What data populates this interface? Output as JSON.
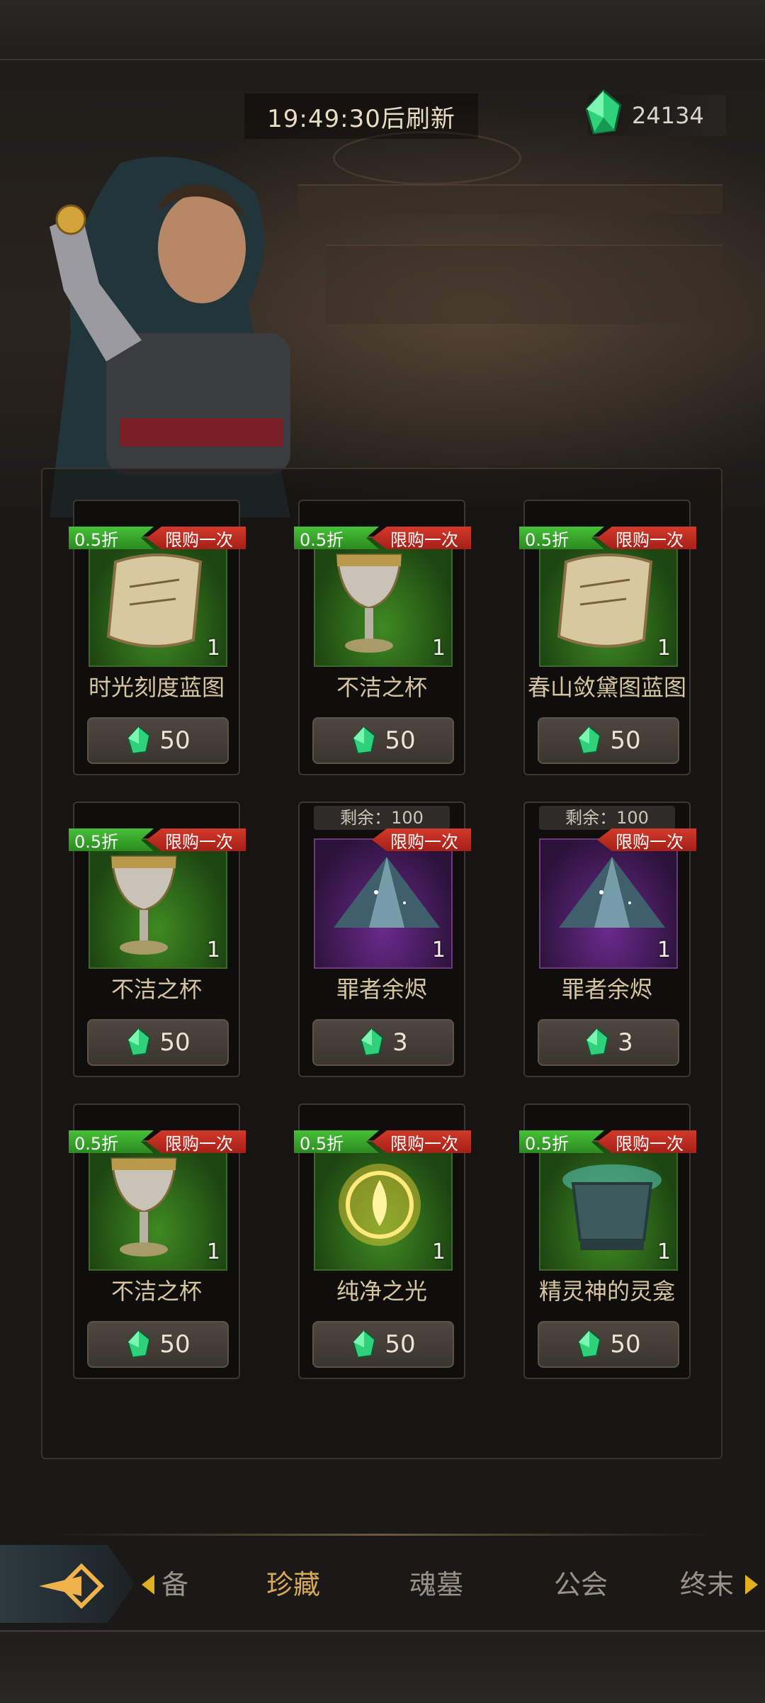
{
  "header": {
    "refresh_text": "19:49:30后刷新",
    "currency_amount": "24134"
  },
  "colors": {
    "discount_tag": "#3aa82c",
    "limit_tag": "#c52b20",
    "active_tab": "#d9a85a",
    "gem_green": "#2fd17a"
  },
  "shop": {
    "items": [
      {
        "discount": "0.5折",
        "limit": "限购一次",
        "name": "时光刻度蓝图",
        "qty": "1",
        "price": "50",
        "icon": "scroll-icon",
        "theme": "green"
      },
      {
        "discount": "0.5折",
        "limit": "限购一次",
        "name": "不洁之杯",
        "qty": "1",
        "price": "50",
        "icon": "chalice-icon",
        "theme": "green"
      },
      {
        "discount": "0.5折",
        "limit": "限购一次",
        "name": "春山敛黛图蓝图",
        "qty": "1",
        "price": "50",
        "icon": "scroll-icon",
        "theme": "green"
      },
      {
        "discount": "0.5折",
        "limit": "限购一次",
        "name": "不洁之杯",
        "qty": "1",
        "price": "50",
        "icon": "chalice-icon",
        "theme": "green"
      },
      {
        "remain": "剩余：100",
        "limit": "限购一次",
        "name": "罪者余烬",
        "qty": "1",
        "price": "3",
        "icon": "ember-pile-icon",
        "theme": "purple"
      },
      {
        "remain": "剩余：100",
        "limit": "限购一次",
        "name": "罪者余烬",
        "qty": "1",
        "price": "3",
        "icon": "ember-pile-icon",
        "theme": "purple"
      },
      {
        "discount": "0.5折",
        "limit": "限购一次",
        "name": "不洁之杯",
        "qty": "1",
        "price": "50",
        "icon": "chalice-icon",
        "theme": "green"
      },
      {
        "discount": "0.5折",
        "limit": "限购一次",
        "name": "纯净之光",
        "qty": "1",
        "price": "50",
        "icon": "light-orb-icon",
        "theme": "green"
      },
      {
        "discount": "0.5折",
        "limit": "限购一次",
        "name": "精灵神的灵龛",
        "qty": "1",
        "price": "50",
        "icon": "shrine-urn-icon",
        "theme": "green"
      }
    ]
  },
  "bottom_nav": {
    "tabs": [
      {
        "label": "备",
        "active": false
      },
      {
        "label": "珍藏",
        "active": true
      },
      {
        "label": "魂墓",
        "active": false
      },
      {
        "label": "公会",
        "active": false
      },
      {
        "label": "终末",
        "active": false
      }
    ]
  }
}
